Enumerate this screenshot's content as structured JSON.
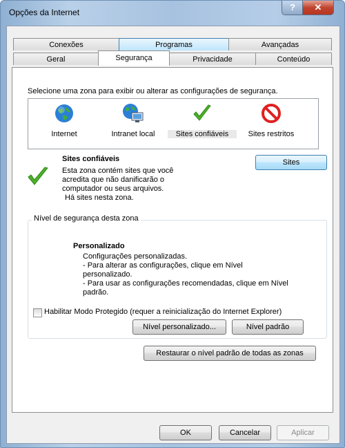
{
  "window": {
    "title": "Opções da Internet",
    "help_glyph": "?",
    "close_glyph": "✕"
  },
  "tabs_row1": [
    "Conexões",
    "Programas",
    "Avançadas"
  ],
  "tabs_row2": [
    "Geral",
    "Segurança",
    "Privacidade",
    "Conteúdo"
  ],
  "instruction": "Selecione uma zona para exibir ou alterar as configurações de segurança.",
  "zones": [
    {
      "label": "Internet",
      "icon": "globe-icon"
    },
    {
      "label": "Intranet local",
      "icon": "intranet-icon"
    },
    {
      "label": "Sites confiáveis",
      "icon": "green-check-icon"
    },
    {
      "label": "Sites restritos",
      "icon": "restricted-icon"
    }
  ],
  "zone_info": {
    "heading": "Sites confiáveis",
    "lines": [
      "Esta zona contém sites que você",
      "acredita que não danificarão o",
      "computador ou seus arquivos.",
      "Há sites nesta zona."
    ],
    "sites_button": "Sites"
  },
  "security_level": {
    "legend": "Nível de segurança desta zona",
    "level_name": "Personalizado",
    "lines": [
      "Configurações personalizadas.",
      "- Para alterar as configurações, clique em Nível",
      "personalizado.",
      "- Para usar as configurações recomendadas, clique em Nível",
      "padrão."
    ],
    "protected_mode_label": "Habilitar Modo Protegido (requer a reinicialização do Internet Explorer)",
    "custom_level_button": "Nível personalizado...",
    "default_level_button": "Nível padrão",
    "restore_all_button": "Restaurar o nível padrão de todas as zonas"
  },
  "footer": {
    "ok": "OK",
    "cancel": "Cancelar",
    "apply": "Aplicar"
  },
  "colors": {
    "accent": "#3c7fb1",
    "check_green": "#4caf2a",
    "restricted_red": "#e02020"
  }
}
